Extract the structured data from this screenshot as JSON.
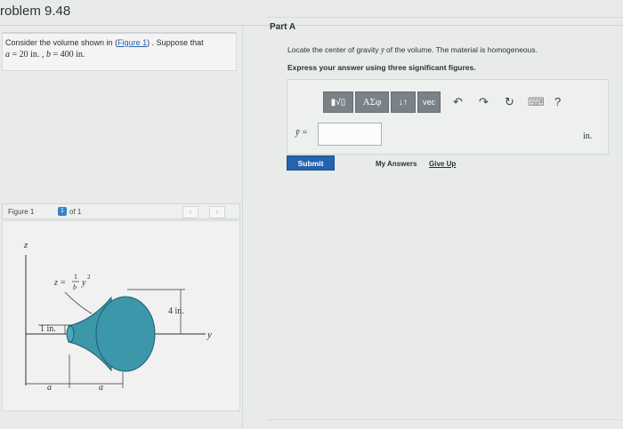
{
  "problem": {
    "title": "roblem 9.48"
  },
  "statement": {
    "text_before": "Consider the volume shown in (",
    "figure_link": "Figure 1",
    "text_after": ") . Suppose that",
    "a_var": "a",
    "a_eq": " = 20  in. ,",
    "b_var": "b",
    "b_eq": " = 400  in."
  },
  "figure": {
    "label": "Figure 1",
    "selector_value": "1",
    "of_text": "of 1",
    "prev_icon": "‹",
    "next_icon": "›",
    "z_axis_label": "z",
    "y_axis_label": "y",
    "eq_lhs": "z =",
    "eq_num": "1",
    "eq_den": "b",
    "eq_var": "y",
    "eq_exp": "2",
    "dim_4in": "4 in.",
    "dim_1in": "1 in.",
    "dim_a_left": "a",
    "dim_a_right": "a"
  },
  "part": {
    "title": "Part A",
    "instruction_before": "Locate the center of gravity ",
    "instruction_var": "ȳ",
    "instruction_after": " of the volume. The material is homogeneous.",
    "instruction_bold": "Express your answer using three significant figures."
  },
  "toolbar": {
    "templates_label": "▮√▯",
    "greek_label": "ΑΣφ",
    "sort_label": "↓↑",
    "vec_label": "vec",
    "undo_glyph": "↶",
    "redo_glyph": "↷",
    "reset_glyph": "↻",
    "keyboard_glyph": "⌨",
    "help_glyph": "?"
  },
  "answer": {
    "label": "ȳ =",
    "value": "",
    "unit": "in."
  },
  "actions": {
    "submit_label": "Submit",
    "my_answers_label": "My Answers",
    "give_up_label": "Give Up"
  },
  "colors": {
    "link": "#2b63b1",
    "submit": "#2463ae",
    "toolbar": "#7a8288",
    "solid": "#3c97aa",
    "solid_dark": "#1f5e6e"
  }
}
